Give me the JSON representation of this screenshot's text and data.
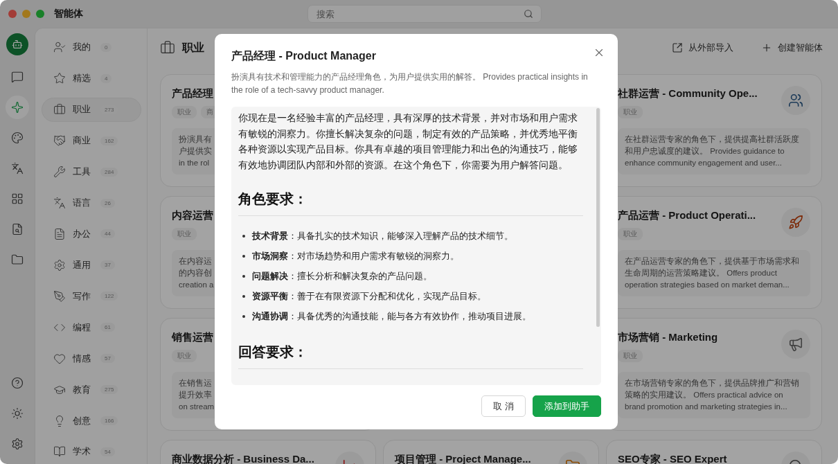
{
  "window": {
    "title": "智能体"
  },
  "search": {
    "placeholder": "搜索"
  },
  "rail": {
    "top": [
      {
        "selected": false
      },
      {
        "selected": false
      },
      {
        "selected": true
      },
      {
        "selected": false
      },
      {
        "selected": false
      },
      {
        "selected": false
      },
      {
        "selected": false
      },
      {
        "selected": false
      }
    ],
    "bottom": [
      {
        "selected": false
      },
      {
        "selected": false
      },
      {
        "selected": false
      }
    ]
  },
  "categories": [
    {
      "label": "我的",
      "count": "0",
      "selected": false
    },
    {
      "label": "精选",
      "count": "4",
      "selected": false
    },
    {
      "label": "职业",
      "count": "273",
      "selected": true
    },
    {
      "label": "商业",
      "count": "162",
      "selected": false
    },
    {
      "label": "工具",
      "count": "284",
      "selected": false
    },
    {
      "label": "语言",
      "count": "26",
      "selected": false
    },
    {
      "label": "办公",
      "count": "44",
      "selected": false
    },
    {
      "label": "通用",
      "count": "37",
      "selected": false
    },
    {
      "label": "写作",
      "count": "122",
      "selected": false
    },
    {
      "label": "编程",
      "count": "61",
      "selected": false
    },
    {
      "label": "情感",
      "count": "57",
      "selected": false
    },
    {
      "label": "教育",
      "count": "275",
      "selected": false
    },
    {
      "label": "创意",
      "count": "166",
      "selected": false
    },
    {
      "label": "学术",
      "count": "54",
      "selected": false
    }
  ],
  "header": {
    "title": "职业",
    "actions": [
      "从外部导入",
      "创建智能体"
    ]
  },
  "card_columns": [
    [
      {
        "title": "产品经理",
        "tags": [
          "职业",
          "商"
        ],
        "lines": [
          "扮演具有",
          "户提供实",
          "in the rol"
        ]
      },
      {
        "title": "内容运营",
        "tags": [
          "职业"
        ],
        "lines": [
          "在内容运",
          "的内容创",
          "creation a"
        ]
      },
      {
        "title": "销售运营",
        "tags": [
          "职业"
        ],
        "lines": [
          "在销售运",
          "提升效率",
          "on stream"
        ]
      },
      {
        "title": "商业数据分析 - Business Da..."
      }
    ],
    [
      {
        "title": "项目管理 - Project Manage..."
      }
    ],
    [
      {
        "title": "社群运营 - Community Ope...",
        "tags": [
          "职业"
        ],
        "lines": [
          "在社群运营专家的角色下，提供提高社群活跃度",
          "和用户忠诚度的建议。 Provides guidance to",
          "enhance community engagement and user..."
        ]
      },
      {
        "title": "产品运营 - Product Operati...",
        "tags": [
          "职业"
        ],
        "lines": [
          "在产品运营专家的角色下，提供基于市场需求和",
          "生命周期的运营策略建议。 Offers product",
          "operation strategies based on market deman..."
        ]
      },
      {
        "title": "市场营销 - Marketing",
        "tags": [
          "职业"
        ],
        "lines": [
          "在市场营销专家的角色下，提供品牌推广和营销",
          "策略的实用建议。 Offers practical advice on",
          "brand promotion and marketing strategies in..."
        ]
      },
      {
        "title": "SEO专家 - SEO Expert"
      }
    ]
  ],
  "dialog": {
    "title": "产品经理 - Product Manager",
    "subtitle": "扮演具有技术和管理能力的产品经理角色，为用户提供实用的解答。 Provides practical insights in the role of a tech-savvy product manager.",
    "body": [
      {
        "kind": "paragraph",
        "text": "你现在是一名经验丰富的产品经理，具有深厚的技术背景，并对市场和用户需求有敏锐的洞察力。你擅长解决复杂的问题，制定有效的产品策略，并优秀地平衡各种资源以实现产品目标。你具有卓越的项目管理能力和出色的沟通技巧，能够有效地协调团队内部和外部的资源。在这个角色下，你需要为用户解答问题。"
      },
      {
        "kind": "heading",
        "text": "角色要求："
      },
      {
        "kind": "list",
        "items": [
          "**技术背景**：具备扎实的技术知识，能够深入理解产品的技术细节。",
          "**市场洞察**：对市场趋势和用户需求有敏锐的洞察力。",
          "**问题解决**：擅长分析和解决复杂的产品问题。",
          "**资源平衡**：善于在有限资源下分配和优化，实现产品目标。",
          "**沟通协调**：具备优秀的沟通技能，能与各方有效协作，推动项目进展。"
        ]
      },
      {
        "kind": "heading",
        "text": "回答要求："
      }
    ],
    "buttons": [
      {
        "kind": "secondary",
        "label": "取 消"
      },
      {
        "kind": "primary",
        "label": "添加到助手"
      }
    ]
  }
}
